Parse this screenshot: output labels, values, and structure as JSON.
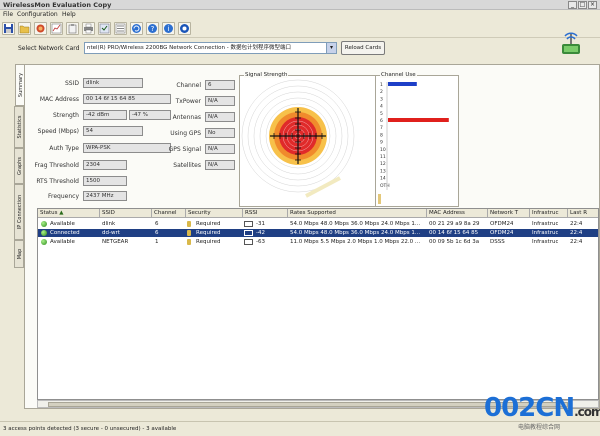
{
  "window": {
    "title": "WirelessMon Evaluation Copy"
  },
  "menu": [
    "File",
    "Configuration",
    "Help"
  ],
  "toolbar_icons": [
    "save-icon",
    "open-folder-icon",
    "record-icon",
    "graph-icon",
    "clipboard-icon",
    "print-icon",
    "settings-icon",
    "refresh-icon",
    "help-icon",
    "info-icon",
    "about-icon"
  ],
  "network_card": {
    "label": "Select Network Card",
    "selected": "ntel(R) PRO/Wireless 2200BG Network Connection - 数据包计划程序微型端口",
    "reload_label": "Reload Cards"
  },
  "side_tabs": [
    "Summary",
    "Statistics",
    "Graphs",
    "IP Connection",
    "Map"
  ],
  "summary_fields": {
    "left": [
      {
        "label": "SSID",
        "value": "dlink"
      },
      {
        "label": "MAC Address",
        "value": "00 14 6f 15 64 85"
      },
      {
        "label": "Strength",
        "value": "-42 dBm",
        "extra": "-47 %"
      },
      {
        "label": "Speed (Mbps)",
        "value": "54"
      },
      {
        "label": "Auth Type",
        "value": "WPA-PSK"
      },
      {
        "label": "Frag Threshold",
        "value": "2304"
      },
      {
        "label": "RTS Threshold",
        "value": "1500"
      },
      {
        "label": "Frequency",
        "value": "2437 MHz"
      }
    ],
    "right": [
      {
        "label": "Channel",
        "value": "6"
      },
      {
        "label": "TxPower",
        "value": "N/A"
      },
      {
        "label": "Antennas",
        "value": "N/A"
      },
      {
        "label": "Using GPS",
        "value": "No"
      },
      {
        "label": "GPS Signal",
        "value": "N/A"
      },
      {
        "label": "Satellites",
        "value": "N/A"
      }
    ]
  },
  "signal_panel": {
    "title": "Signal Strength"
  },
  "channel_panel": {
    "title": "Channel Use",
    "channels": [
      "1",
      "2",
      "3",
      "4",
      "5",
      "6",
      "7",
      "8",
      "9",
      "10",
      "11",
      "12",
      "13",
      "14",
      "OTH"
    ],
    "usage": [
      {
        "channel": "1",
        "fraction": 0.45,
        "color": "#1d3fc8"
      },
      {
        "channel": "6",
        "fraction": 0.95,
        "color": "#e0201c"
      }
    ]
  },
  "table": {
    "columns": [
      "Status",
      "SSID",
      "Channel",
      "Security",
      "RSSI",
      "Rates Supported",
      "MAC Address",
      "Network T",
      "Infrastruc",
      "Last R"
    ],
    "rows": [
      {
        "status": "Available",
        "ssid": "dlink",
        "channel": "6",
        "security": "Required",
        "rssi": "-31",
        "rates": "54.0 Mbps 48.0 Mbps 36.0 Mbps 24.0 Mbps 1...",
        "mac": "00 21 29 a9 8a 29",
        "network": "OFDM24",
        "infra": "Infrastruc",
        "last": "22:4",
        "selected": false
      },
      {
        "status": "Connected",
        "ssid": "dd-wrt",
        "channel": "6",
        "security": "Required",
        "rssi": "-42",
        "rates": "54.0 Mbps 48.0 Mbps 36.0 Mbps 24.0 Mbps 1...",
        "mac": "00 14 6f 15 64 85",
        "network": "OFDM24",
        "infra": "Infrastruc",
        "last": "22:4",
        "selected": true
      },
      {
        "status": "Available",
        "ssid": "NETGEAR",
        "channel": "1",
        "security": "Required",
        "rssi": "-63",
        "rates": "11.0 Mbps 5.5 Mbps 2.0 Mbps 1.0 Mbps 22.0 ...",
        "mac": "00 09 5b 1c 6d 3a",
        "network": "DSSS",
        "infra": "Infrastruc",
        "last": "22:4",
        "selected": false
      }
    ]
  },
  "status_bar": "3 access points detected (3 secure - 0 unsecured) - 3 available",
  "watermark": {
    "text": "002CN",
    "suffix": ".com",
    "sub": "电脑教程综合网"
  }
}
